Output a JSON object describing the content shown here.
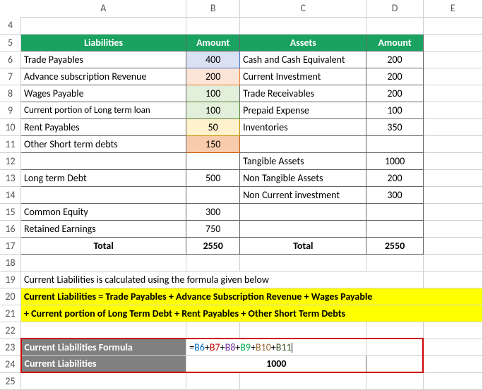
{
  "columns": {
    "A": "A",
    "B": "B",
    "C": "C",
    "D": "D",
    "E": "E"
  },
  "rows": {
    "r4": "4",
    "r5": "5",
    "r6": "6",
    "r7": "7",
    "r8": "8",
    "r9": "9",
    "r10": "10",
    "r11": "11",
    "r12": "12",
    "r13": "13",
    "r14": "14",
    "r15": "15",
    "r16": "16",
    "r17": "17",
    "r18": "18",
    "r19": "19",
    "r20": "20",
    "r21": "21",
    "r22": "22",
    "r23": "23",
    "r24": "24",
    "r25": "25"
  },
  "hdr": {
    "liabilities": "Liabilities",
    "amount1": "Amount",
    "assets": "Assets",
    "amount2": "Amount"
  },
  "liab": {
    "tp": {
      "label": "Trade Payables",
      "val": "400"
    },
    "asr": {
      "label": "Advance subscription Revenue",
      "val": "200"
    },
    "wp": {
      "label": "Wages Payable",
      "val": "100"
    },
    "cpl": {
      "label": "Current portion of Long term loan",
      "val": "100"
    },
    "rp": {
      "label": "Rent Payables",
      "val": "50"
    },
    "ost": {
      "label": "Other Short term debts",
      "val": "150"
    },
    "ltd": {
      "label": "Long term Debt",
      "val": "500"
    },
    "ce": {
      "label": "Common Equity",
      "val": "300"
    },
    "re": {
      "label": "Retained Earnings",
      "val": "750"
    }
  },
  "assets": {
    "cce": {
      "label": "Cash and Cash Equivalent",
      "val": "200"
    },
    "ci": {
      "label": "Current Investment",
      "val": "200"
    },
    "tr": {
      "label": "Trade Receivables",
      "val": "200"
    },
    "pe": {
      "label": "Prepaid Expense",
      "val": "100"
    },
    "inv": {
      "label": "Inventories",
      "val": "350"
    },
    "ta": {
      "label": "Tangible Assets",
      "val": "1000"
    },
    "nta": {
      "label": "Non Tangible Assets",
      "val": "200"
    },
    "nci": {
      "label": "Non Current investment",
      "val": "300"
    }
  },
  "totals": {
    "label": "Total",
    "left": "2550",
    "right": "2550"
  },
  "note": {
    "r19": "Current Liabilities is calculated using the formula given below"
  },
  "yellow": {
    "l1": "Current Liabilities = Trade Payables + Advance Subscription Revenue + Wages Payable",
    "l2": " + Current portion of Long Term Debt + Rent Payables + Other Short Term Debts"
  },
  "result": {
    "label1": "Current Liabilities Formula",
    "label2": "Current Liabilities",
    "value": "1000"
  },
  "formula": {
    "eq": "=",
    "b6": "B6",
    "b7": "B7",
    "b8": "B8",
    "b9": "B9",
    "b10": "B10",
    "b11": "B11",
    "plus": "+"
  }
}
